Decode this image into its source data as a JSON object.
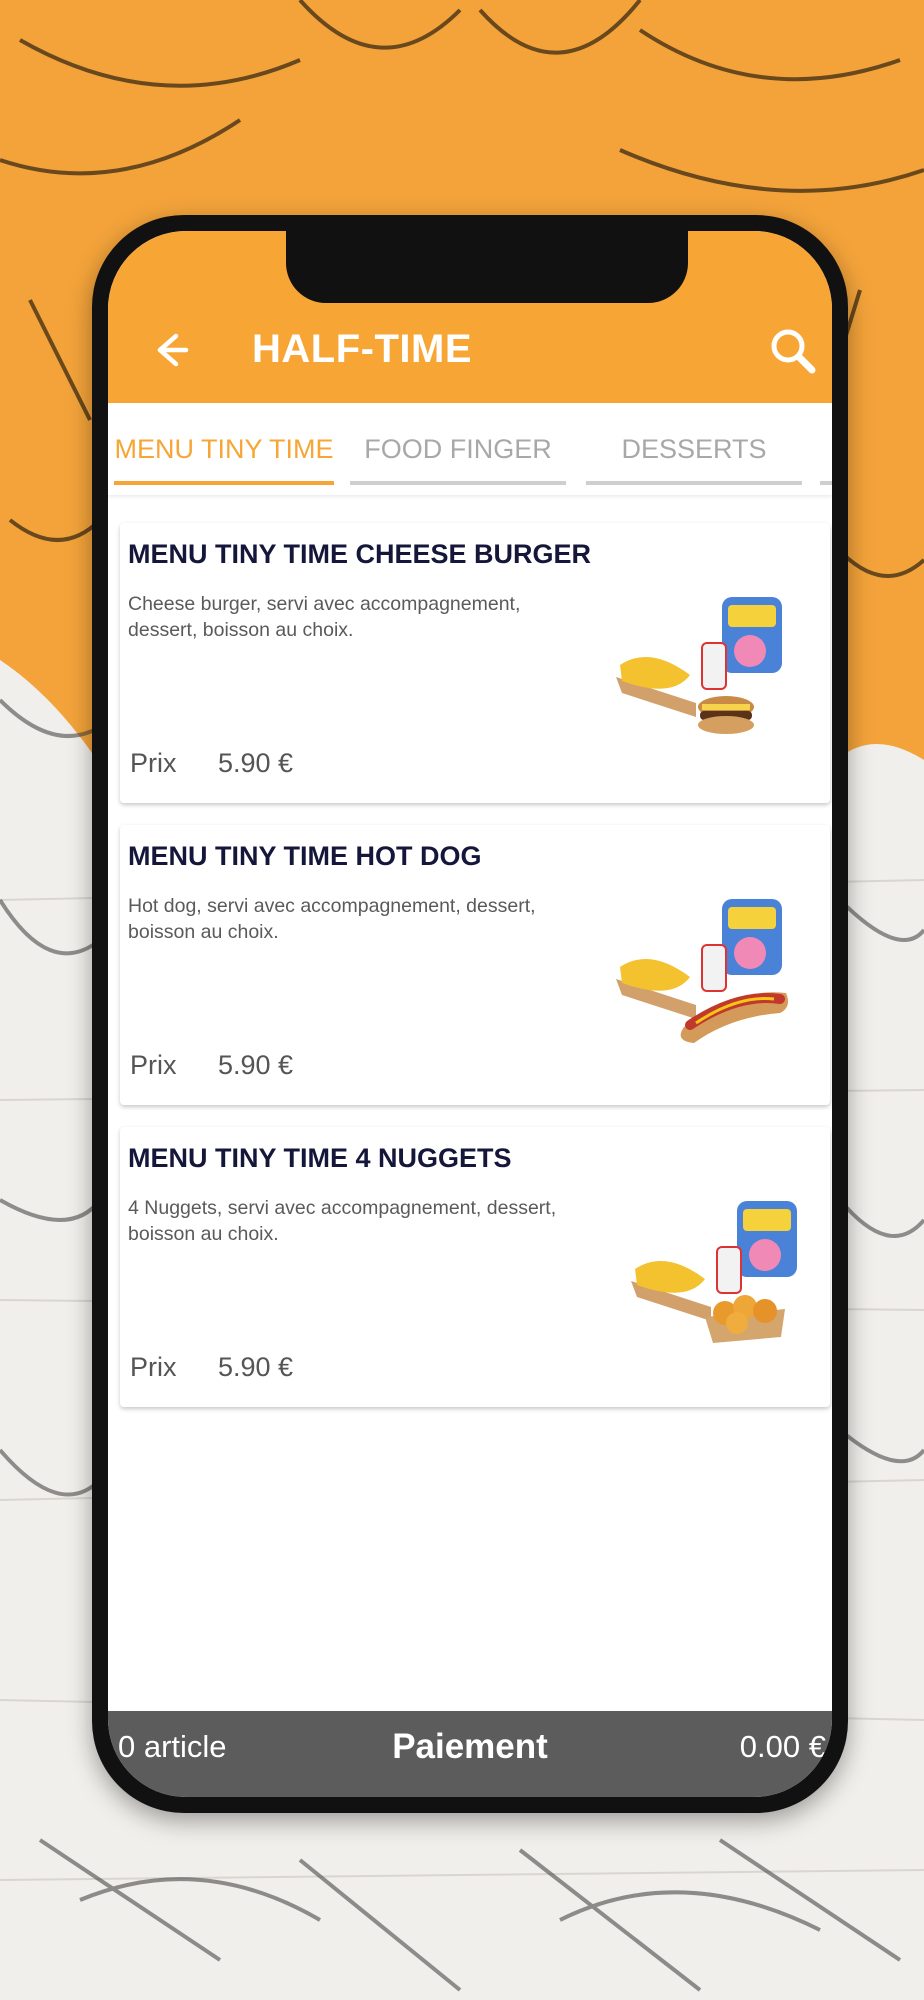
{
  "header": {
    "title": "HALF-TIME"
  },
  "tabs": [
    {
      "label": "MENU TINY TIME",
      "active": true
    },
    {
      "label": "FOOD FINGER",
      "active": false
    },
    {
      "label": "DESSERTS",
      "active": false
    }
  ],
  "items": [
    {
      "title": "MENU TINY TIME CHEESE BURGER",
      "description": "Cheese burger, servi avec accompagnement, dessert, boisson au choix.",
      "price_label": "Prix",
      "price": "5.90 €",
      "image": "burger-menu-image"
    },
    {
      "title": "MENU TINY TIME HOT DOG",
      "description": "Hot dog, servi avec accompagnement, dessert, boisson au choix.",
      "price_label": "Prix",
      "price": "5.90 €",
      "image": "hotdog-menu-image"
    },
    {
      "title": "MENU TINY TIME 4 NUGGETS",
      "description": "4 Nuggets, servi avec accompagnement, dessert, boisson au choix.",
      "price_label": "Prix",
      "price": "5.90 €",
      "image": "nuggets-menu-image"
    }
  ],
  "footer": {
    "count": "0 article",
    "pay_label": "Paiement",
    "total": "0.00 €"
  },
  "colors": {
    "brand": "#f7a535",
    "title_text": "#14173a",
    "footer_bg": "#5c5c5c"
  }
}
